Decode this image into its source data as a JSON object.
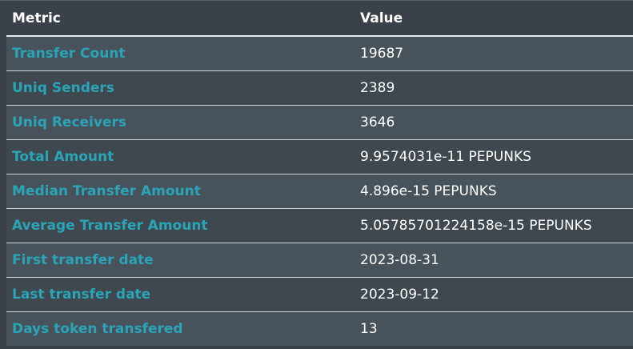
{
  "table": {
    "headers": [
      "Metric",
      "Value"
    ],
    "rows": [
      {
        "metric": "Transfer Count",
        "value": "19687"
      },
      {
        "metric": "Uniq Senders",
        "value": "2389"
      },
      {
        "metric": "Uniq Receivers",
        "value": "3646"
      },
      {
        "metric": "Total Amount",
        "value": "9.9574031e-11 PEPUNKS"
      },
      {
        "metric": "Median Transfer Amount",
        "value": "4.896e-15 PEPUNKS"
      },
      {
        "metric": "Average Transfer Amount",
        "value": "5.05785701224158e-15 PEPUNKS"
      },
      {
        "metric": "First transfer date",
        "value": "2023-08-31"
      },
      {
        "metric": "Last transfer date",
        "value": "2023-09-12"
      },
      {
        "metric": "Days token transfered",
        "value": "13"
      }
    ]
  },
  "colors": {
    "background": "#3a4149",
    "row_odd": "#48525b",
    "row_even": "#3f474f",
    "metric_text": "#2aa5b8",
    "value_text": "#ffffff"
  }
}
